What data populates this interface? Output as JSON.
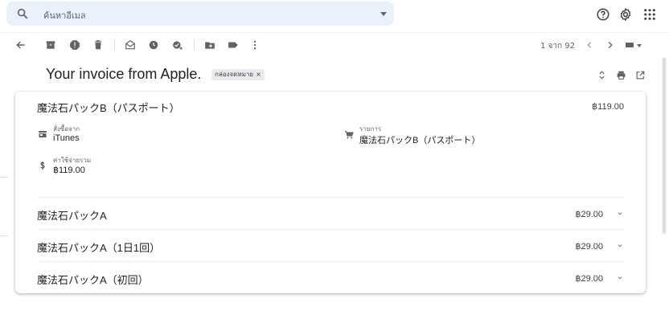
{
  "search": {
    "placeholder": "ค้นหาอีเมล"
  },
  "toolbar": {
    "pager_text": "1 จาก 92"
  },
  "message": {
    "subject": "Your invoice from Apple.",
    "label_chip": "กล่องจดหมาย",
    "label_chip_remove": "×"
  },
  "invoice": {
    "main_item": {
      "title": "魔法石パックB（パスポート）",
      "price": "฿119.00",
      "ordered_from_label": "สั่งซื้อจาก",
      "ordered_from_value": "iTunes",
      "items_label": "รายการ",
      "items_value": "魔法石パックB（パスポート）",
      "total_label": "ค่าใช้จ่ายรวม",
      "total_value": "฿119.00"
    },
    "rows": [
      {
        "title": "魔法石パックA",
        "price": "฿29.00"
      },
      {
        "title": "魔法石パックA（1日1回）",
        "price": "฿29.00"
      },
      {
        "title": "魔法石パックA（初回）",
        "price": "฿29.00"
      }
    ]
  },
  "colors": {
    "search_bg": "#eaf1fb",
    "icon_gray": "#5f6368",
    "text_dark": "#202124",
    "chip_bg": "#e8eaed"
  }
}
